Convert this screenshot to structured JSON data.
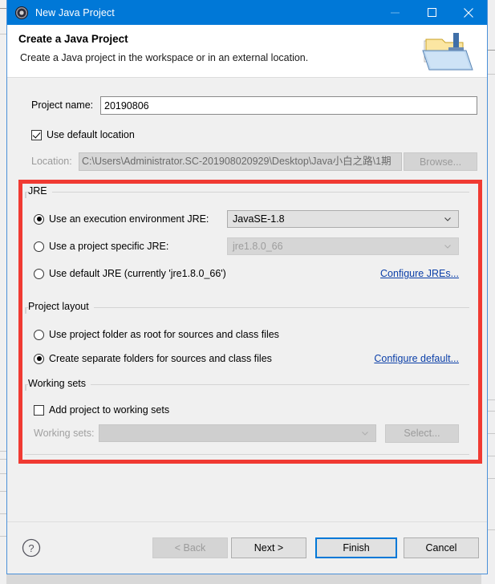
{
  "window": {
    "title": "New Java Project",
    "icon": "eclipse-gear-icon",
    "minimize_label": "Minimize",
    "maximize_label": "Maximize",
    "close_label": "Close"
  },
  "header": {
    "title": "Create a Java Project",
    "description": "Create a Java project in the workspace or in an external location.",
    "icon": "java-project-folder-icon"
  },
  "form": {
    "project_name_label": "Project name:",
    "project_name_value": "20190806",
    "project_name_placeholder": "",
    "use_default_location_label": "Use default location",
    "use_default_location_checked": true,
    "location_label": "Location:",
    "location_value": "C:\\Users\\Administrator.SC-201908020929\\Desktop\\Java小白之路\\1期",
    "browse_label": "Browse..."
  },
  "jre": {
    "group_title": "JRE",
    "options": [
      {
        "label": "Use an execution environment JRE:",
        "selected": true,
        "combo_value": "JavaSE-1.8",
        "combo_enabled": true
      },
      {
        "label": "Use a project specific JRE:",
        "selected": false,
        "combo_value": "jre1.8.0_66",
        "combo_enabled": false
      },
      {
        "label": "Use default JRE (currently 'jre1.8.0_66')",
        "selected": false
      }
    ],
    "configure_link": "Configure JREs..."
  },
  "project_layout": {
    "group_title": "Project layout",
    "options": [
      {
        "label": "Use project folder as root for sources and class files",
        "selected": false
      },
      {
        "label": "Create separate folders for sources and class files",
        "selected": true
      }
    ],
    "configure_link": "Configure default..."
  },
  "working_sets": {
    "group_title": "Working sets",
    "add_label": "Add project to working sets",
    "add_checked": false,
    "sets_label": "Working sets:",
    "sets_value": "",
    "select_label": "Select..."
  },
  "buttons": {
    "help": "?",
    "back": "< Back",
    "next": "Next >",
    "finish": "Finish",
    "cancel": "Cancel"
  },
  "annotation": {
    "color": "#f03a32",
    "kind": "highlight-rectangle"
  }
}
